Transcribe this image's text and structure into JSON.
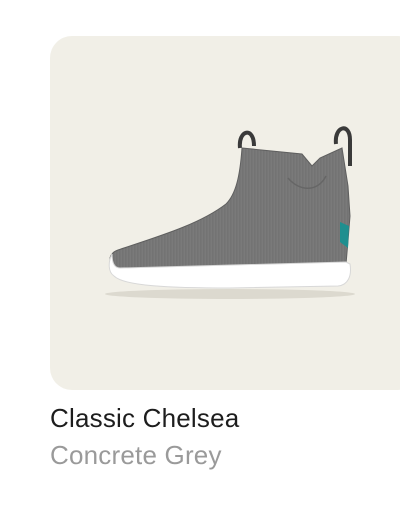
{
  "product": {
    "name": "Classic Chelsea",
    "color": "Concrete Grey",
    "image_alt": "Classic Chelsea shoe in Concrete Grey",
    "colors": {
      "card_background": "#f1efe7",
      "upper": "#7a7a7a",
      "sole": "#ffffff",
      "accent_tab": "#1f8f8f",
      "name_text": "#1d1d1d",
      "color_text": "#9a9a9a"
    }
  }
}
